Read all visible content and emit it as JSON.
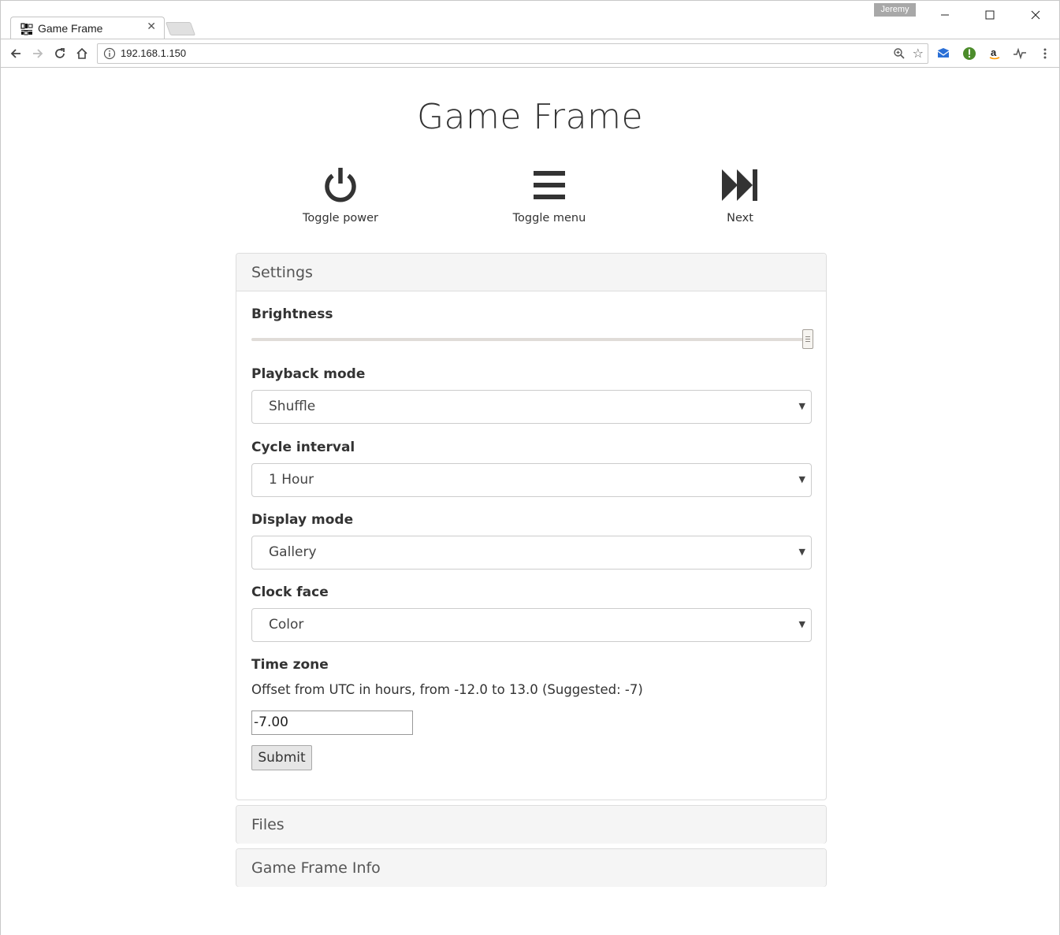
{
  "browser": {
    "tab_title": "Game Frame",
    "tab_favicon_text": "GAME FRAME",
    "tab_close": "✕",
    "profile_name": "Jeremy",
    "url": "192.168.1.150"
  },
  "page": {
    "title": "Game Frame",
    "actions": {
      "power_label": "Toggle power",
      "menu_label": "Toggle menu",
      "next_label": "Next"
    },
    "settings": {
      "heading": "Settings",
      "brightness": {
        "label": "Brightness",
        "value_fraction": 1.0
      },
      "playback_mode": {
        "label": "Playback mode",
        "value": "Shuffle"
      },
      "cycle_interval": {
        "label": "Cycle interval",
        "value": "1 Hour"
      },
      "display_mode": {
        "label": "Display mode",
        "value": "Gallery"
      },
      "clock_face": {
        "label": "Clock face",
        "value": "Color"
      },
      "time_zone": {
        "label": "Time zone",
        "help": "Offset from UTC in hours, from -12.0 to 13.0 (Suggested: -7)",
        "value": "-7.00"
      },
      "submit_label": "Submit"
    },
    "files_heading": "Files",
    "info_heading": "Game Frame Info"
  },
  "colors": {
    "accent_green": "#4c8c2b",
    "amazon_orange": "#f90",
    "mail_blue": "#2a6fd6"
  }
}
